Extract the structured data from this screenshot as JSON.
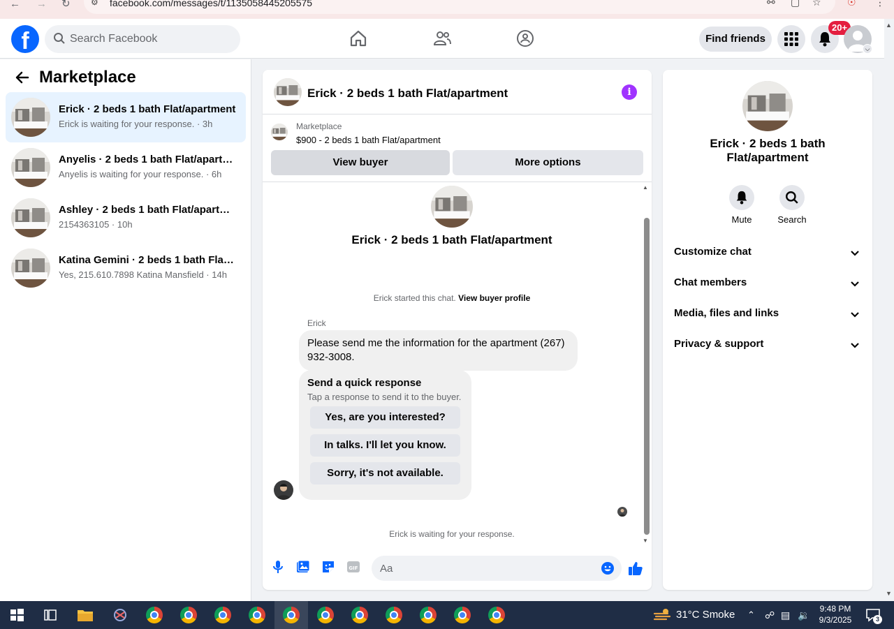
{
  "browser": {
    "url": "facebook.com/messages/t/1135058445205575"
  },
  "header": {
    "search_placeholder": "Search Facebook",
    "find_friends": "Find friends",
    "notifications_badge": "20+"
  },
  "left": {
    "title": "Marketplace",
    "conversations": [
      {
        "name": "Erick · 2 beds 1 bath Flat/apartment",
        "sub": "Erick is waiting for your response. · 3h",
        "active": true
      },
      {
        "name": "Anyelis · 2 beds 1 bath Flat/apartm...",
        "sub": "Anyelis is waiting for your response. · 6h",
        "active": false
      },
      {
        "name": "Ashley · 2 beds 1 bath Flat/apartm...",
        "sub": "2154363105 · 10h",
        "active": false
      },
      {
        "name": "Katina Gemini · 2 beds 1 bath Flat/...",
        "sub": "Yes, 215.610.7898 Katina Mansfield · 14h",
        "active": false
      }
    ]
  },
  "chat": {
    "title": "Erick · 2 beds 1 bath Flat/apartment",
    "listing": {
      "kind": "Marketplace",
      "price_title": "$900 - 2 beds 1 bath Flat/apartment",
      "view_buyer": "View buyer",
      "more_options": "More options"
    },
    "big_title": "Erick · 2 beds 1 bath Flat/apartment",
    "started_text": "Erick started this chat.",
    "view_buyer_profile": "View buyer profile",
    "sender": "Erick",
    "message": "Please send me the information for the apartment (267) 932-3008.",
    "quick": {
      "title": "Send a quick response",
      "subtitle": "Tap a response to send it to the buyer.",
      "options": [
        "Yes, are you interested?",
        "In talks. I'll let you know.",
        "Sorry, it's not available."
      ]
    },
    "waiting": "Erick is waiting for your response.",
    "composer_placeholder": "Aa"
  },
  "right": {
    "name": "Erick · 2 beds 1 bath Flat/apartment",
    "mute": "Mute",
    "search": "Search",
    "sections": [
      "Customize chat",
      "Chat members",
      "Media, files and links",
      "Privacy & support"
    ]
  },
  "taskbar": {
    "weather": "31°C  Smoke",
    "time": "9:48 PM",
    "date": "9/3/2025",
    "notif_count": "3"
  },
  "colors": {
    "fb_blue": "#0866ff",
    "active_conv": "#e7f3ff",
    "info_purple": "#a033ff",
    "badge_red": "#e41e3f",
    "taskbar": "#1f2d45"
  }
}
